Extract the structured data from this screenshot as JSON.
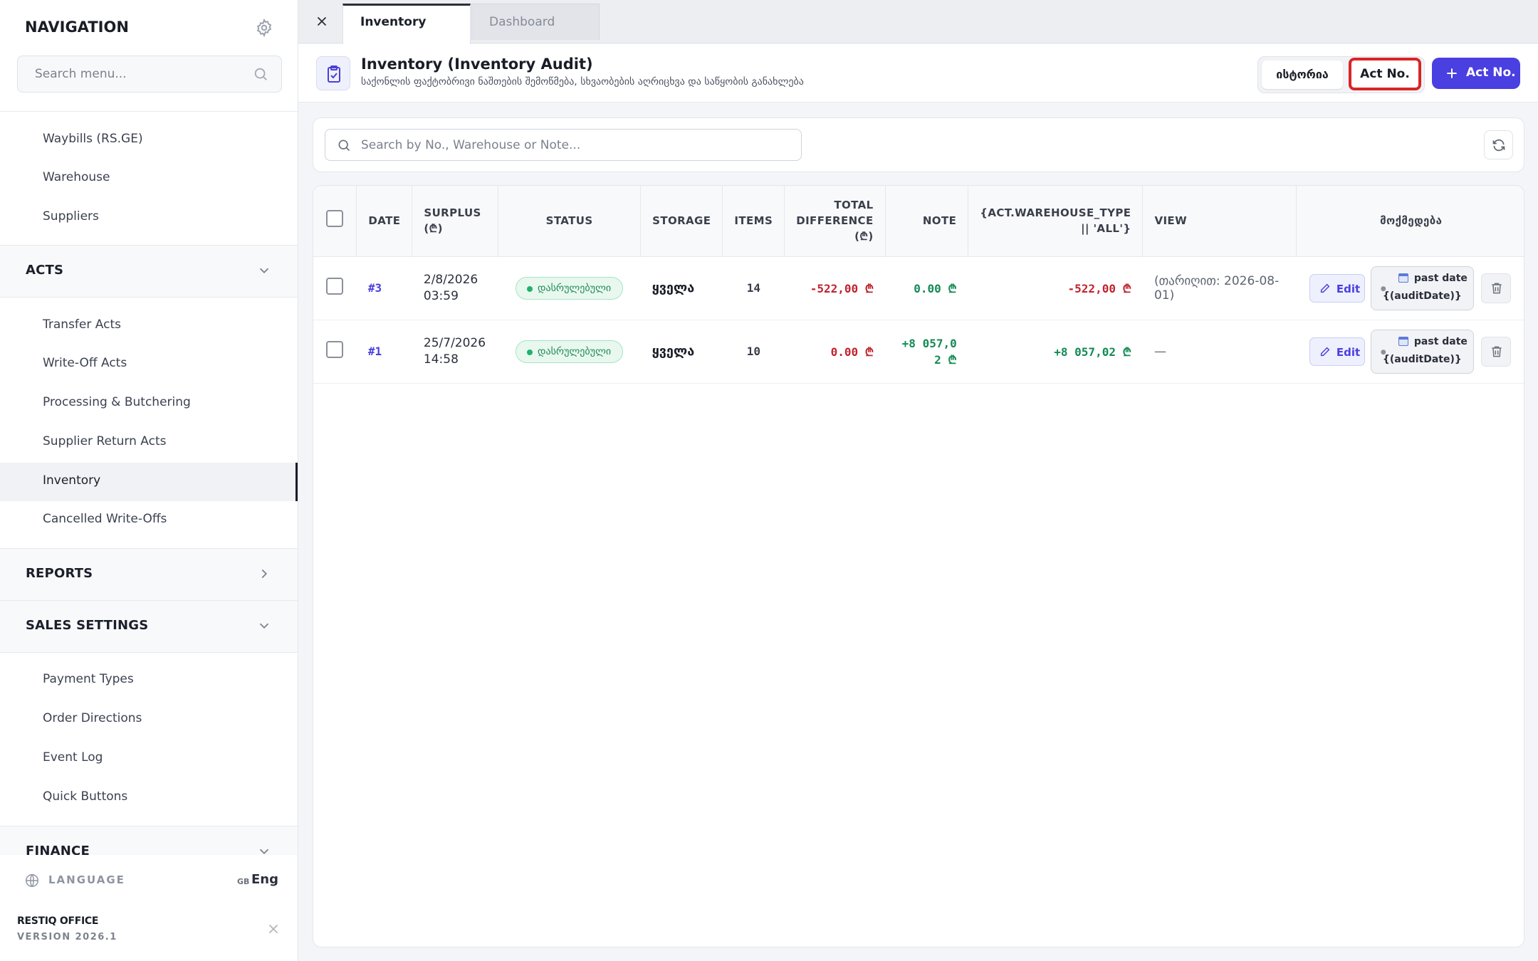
{
  "sidebar": {
    "title": "NAVIGATION",
    "search_placeholder": "Search menu...",
    "group_items": [
      "Waybills (RS.GE)",
      "Warehouse",
      "Suppliers"
    ],
    "acts_label": "ACTS",
    "acts_items": [
      "Transfer Acts",
      "Write-Off Acts",
      "Processing & Butchering",
      "Supplier Return Acts",
      "Inventory",
      "Cancelled Write-Offs"
    ],
    "reports_label": "REPORTS",
    "sales_settings_label": "SALES SETTINGS",
    "sales_items": [
      "Payment Types",
      "Order Directions",
      "Event Log",
      "Quick Buttons"
    ],
    "finance_label": "FINANCE",
    "language_label": "LANGUAGE",
    "language_flag": "GB",
    "language_value": "Eng",
    "brand": "RESTIQ OFFICE",
    "version": "VERSION 2026.1"
  },
  "tabs": [
    "Inventory",
    "Dashboard"
  ],
  "header": {
    "title": "Inventory (Inventory Audit)",
    "subtitle": "საქონლის ფაქტობრივი ნაშთების შემოწმება, სხვაობების აღრიცხვა და საწყობის განახლება",
    "history_button": "ისტორია",
    "act_button": "Act No.",
    "primary_button": "Act No."
  },
  "search": {
    "placeholder": "Search by No., Warehouse or Note..."
  },
  "table": {
    "headers": [
      "DATE",
      "SURPLUS (₾)",
      "STATUS",
      "STORAGE",
      "ITEMS",
      "TOTAL DIFFERENCE (₾)",
      "NOTE",
      "{ACT.WAREHOUSE_TYPE || 'ALL'}",
      "VIEW",
      "მოქმედება"
    ],
    "rows": [
      {
        "id": "#3",
        "date_line1": "2/8/2026",
        "date_line2": "03:59",
        "status": "დასრულებული",
        "storage": "ყველა",
        "items": "14",
        "surplus": "-522,00 ₾",
        "total_difference": "0.00 ₾",
        "note": "-522,00 ₾",
        "view": "(თარიღით: 2026-08-01)",
        "edit_label": "Edit",
        "past_line1": "past date",
        "past_line2": "{(auditDate)}"
      },
      {
        "id": "#1",
        "date_line1": "25/7/2026",
        "date_line2": "14:58",
        "status": "დასრულებული",
        "storage": "ყველა",
        "items": "10",
        "surplus": "0.00 ₾",
        "total_difference": "+8 057,02 ₾",
        "note": "+8 057,02 ₾",
        "view": "—",
        "edit_label": "Edit",
        "past_line1": "past date",
        "past_line2": "{(auditDate)}"
      }
    ]
  }
}
